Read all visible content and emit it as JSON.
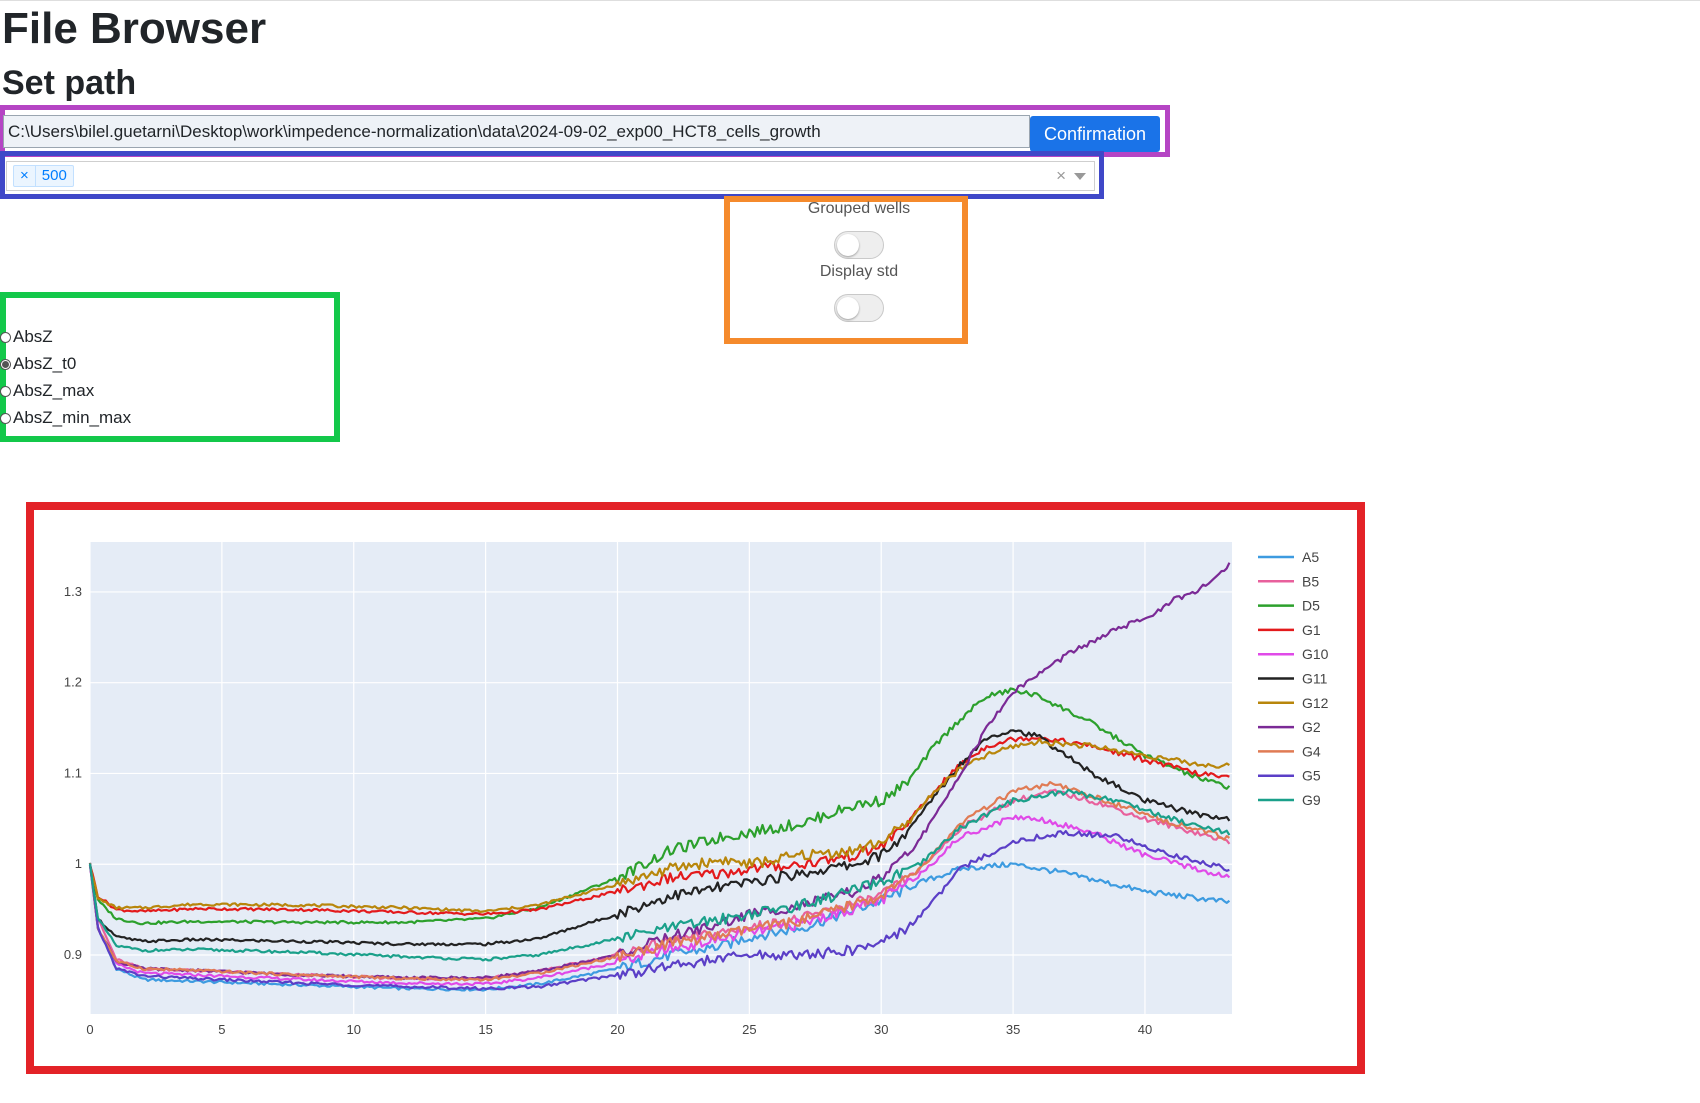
{
  "page": {
    "title": "File Browser",
    "subtitle": "Set path"
  },
  "path_row": {
    "path_value": "C:\\Users\\bilel.guetarni\\Desktop\\work\\impedence-normalization\\data\\2024-09-02_exp00_HCT8_cells_growth",
    "confirm_label": "Confirmation"
  },
  "multiselect": {
    "selected": [
      "500"
    ],
    "remove_tag_glyph": "×",
    "clear_glyph": "×"
  },
  "toggles": [
    {
      "label": "Grouped wells",
      "on": false
    },
    {
      "label": "Display std",
      "on": false
    }
  ],
  "normalization": {
    "options": [
      "AbsZ",
      "AbsZ_t0",
      "AbsZ_max",
      "AbsZ_min_max"
    ],
    "selected": "AbsZ_t0"
  },
  "chart_data": {
    "type": "line",
    "title": "",
    "xlabel": "",
    "ylabel": "",
    "xlim": [
      0,
      43.3
    ],
    "ylim": [
      0.835,
      1.355
    ],
    "x_ticks": [
      0,
      5,
      10,
      15,
      20,
      25,
      30,
      35,
      40
    ],
    "y_ticks": [
      0.9,
      1,
      1.1,
      1.2,
      1.3
    ],
    "grid": true,
    "legend_position": "right",
    "background": "#e5ecf6",
    "series": [
      {
        "name": "A5",
        "color": "#3d9be0",
        "points": [
          [
            0,
            1
          ],
          [
            0.3,
            0.93
          ],
          [
            1,
            0.885
          ],
          [
            2,
            0.873
          ],
          [
            4,
            0.871
          ],
          [
            8,
            0.867
          ],
          [
            12,
            0.863
          ],
          [
            15,
            0.862
          ],
          [
            17,
            0.868
          ],
          [
            20,
            0.885
          ],
          [
            22,
            0.9
          ],
          [
            24,
            0.91
          ],
          [
            25,
            0.92
          ],
          [
            27,
            0.93
          ],
          [
            30,
            0.96
          ],
          [
            31.5,
            0.98
          ],
          [
            33,
            0.995
          ],
          [
            35,
            1.0
          ],
          [
            37,
            0.99
          ],
          [
            40,
            0.97
          ],
          [
            43.2,
            0.958
          ]
        ]
      },
      {
        "name": "B5",
        "color": "#e8609c",
        "points": [
          [
            0,
            1
          ],
          [
            0.3,
            0.94
          ],
          [
            1,
            0.895
          ],
          [
            2,
            0.885
          ],
          [
            4,
            0.883
          ],
          [
            8,
            0.878
          ],
          [
            12,
            0.874
          ],
          [
            15,
            0.874
          ],
          [
            17,
            0.882
          ],
          [
            20,
            0.9
          ],
          [
            22,
            0.915
          ],
          [
            24,
            0.925
          ],
          [
            25,
            0.93
          ],
          [
            27,
            0.94
          ],
          [
            30,
            0.965
          ],
          [
            31.5,
            0.995
          ],
          [
            33,
            1.04
          ],
          [
            35,
            1.07
          ],
          [
            36.5,
            1.08
          ],
          [
            38,
            1.07
          ],
          [
            40,
            1.05
          ],
          [
            43.2,
            1.025
          ]
        ]
      },
      {
        "name": "D5",
        "color": "#2ca02c",
        "points": [
          [
            0,
            1
          ],
          [
            0.3,
            0.96
          ],
          [
            1,
            0.94
          ],
          [
            2,
            0.935
          ],
          [
            4,
            0.937
          ],
          [
            8,
            0.936
          ],
          [
            12,
            0.936
          ],
          [
            15,
            0.94
          ],
          [
            17,
            0.952
          ],
          [
            20,
            0.985
          ],
          [
            22,
            1.015
          ],
          [
            24,
            1.03
          ],
          [
            25,
            1.035
          ],
          [
            27,
            1.045
          ],
          [
            29,
            1.065
          ],
          [
            30,
            1.07
          ],
          [
            31,
            1.09
          ],
          [
            32,
            1.13
          ],
          [
            33,
            1.16
          ],
          [
            34,
            1.185
          ],
          [
            35,
            1.192
          ],
          [
            36,
            1.185
          ],
          [
            38,
            1.155
          ],
          [
            40,
            1.12
          ],
          [
            42,
            1.095
          ],
          [
            43.2,
            1.085
          ]
        ]
      },
      {
        "name": "G1",
        "color": "#e31a1c",
        "points": [
          [
            0,
            1
          ],
          [
            0.3,
            0.965
          ],
          [
            1,
            0.95
          ],
          [
            2,
            0.948
          ],
          [
            4,
            0.951
          ],
          [
            8,
            0.95
          ],
          [
            12,
            0.947
          ],
          [
            15,
            0.945
          ],
          [
            17,
            0.95
          ],
          [
            20,
            0.97
          ],
          [
            22,
            0.985
          ],
          [
            24,
            0.99
          ],
          [
            25,
            0.995
          ],
          [
            27,
            1.0
          ],
          [
            29,
            1.01
          ],
          [
            30,
            1.02
          ],
          [
            31,
            1.045
          ],
          [
            32,
            1.08
          ],
          [
            33,
            1.11
          ],
          [
            34,
            1.13
          ],
          [
            35,
            1.138
          ],
          [
            36,
            1.14
          ],
          [
            38,
            1.13
          ],
          [
            40,
            1.115
          ],
          [
            42,
            1.1
          ],
          [
            43.2,
            1.095
          ]
        ]
      },
      {
        "name": "G10",
        "color": "#e04ae8",
        "points": [
          [
            0,
            1
          ],
          [
            0.3,
            0.93
          ],
          [
            1,
            0.89
          ],
          [
            2,
            0.88
          ],
          [
            4,
            0.878
          ],
          [
            8,
            0.873
          ],
          [
            12,
            0.869
          ],
          [
            15,
            0.868
          ],
          [
            17,
            0.875
          ],
          [
            20,
            0.892
          ],
          [
            22,
            0.907
          ],
          [
            24,
            0.918
          ],
          [
            25,
            0.925
          ],
          [
            27,
            0.935
          ],
          [
            30,
            0.96
          ],
          [
            31.5,
            0.99
          ],
          [
            33,
            1.03
          ],
          [
            35,
            1.052
          ],
          [
            36,
            1.05
          ],
          [
            38,
            1.035
          ],
          [
            40,
            1.01
          ],
          [
            43.2,
            0.985
          ]
        ]
      },
      {
        "name": "G11",
        "color": "#222222",
        "points": [
          [
            0,
            1
          ],
          [
            0.3,
            0.94
          ],
          [
            1,
            0.92
          ],
          [
            2,
            0.915
          ],
          [
            4,
            0.917
          ],
          [
            8,
            0.915
          ],
          [
            12,
            0.912
          ],
          [
            15,
            0.912
          ],
          [
            17,
            0.918
          ],
          [
            20,
            0.945
          ],
          [
            22,
            0.965
          ],
          [
            24,
            0.975
          ],
          [
            25,
            0.98
          ],
          [
            27,
            0.99
          ],
          [
            29,
            1.0
          ],
          [
            30,
            1.01
          ],
          [
            31,
            1.035
          ],
          [
            32,
            1.075
          ],
          [
            33,
            1.11
          ],
          [
            34,
            1.14
          ],
          [
            35,
            1.148
          ],
          [
            36,
            1.14
          ],
          [
            38,
            1.1
          ],
          [
            40,
            1.07
          ],
          [
            42,
            1.055
          ],
          [
            43.2,
            1.05
          ]
        ]
      },
      {
        "name": "G12",
        "color": "#b8860b",
        "points": [
          [
            0,
            1
          ],
          [
            0.3,
            0.962
          ],
          [
            1,
            0.952
          ],
          [
            2,
            0.952
          ],
          [
            4,
            0.956
          ],
          [
            8,
            0.955
          ],
          [
            12,
            0.952
          ],
          [
            15,
            0.948
          ],
          [
            17,
            0.955
          ],
          [
            20,
            0.978
          ],
          [
            22,
            0.995
          ],
          [
            24,
            1.005
          ],
          [
            25,
            1.0
          ],
          [
            27,
            1.01
          ],
          [
            29,
            1.015
          ],
          [
            30,
            1.025
          ],
          [
            31,
            1.045
          ],
          [
            32,
            1.08
          ],
          [
            33,
            1.105
          ],
          [
            34,
            1.12
          ],
          [
            35,
            1.13
          ],
          [
            36,
            1.135
          ],
          [
            38,
            1.13
          ],
          [
            40,
            1.12
          ],
          [
            42,
            1.11
          ],
          [
            43.2,
            1.108
          ]
        ]
      },
      {
        "name": "G2",
        "color": "#7b2a96",
        "points": [
          [
            0,
            1
          ],
          [
            0.3,
            0.93
          ],
          [
            1,
            0.893
          ],
          [
            2,
            0.885
          ],
          [
            4,
            0.883
          ],
          [
            8,
            0.878
          ],
          [
            12,
            0.875
          ],
          [
            15,
            0.875
          ],
          [
            17,
            0.882
          ],
          [
            20,
            0.9
          ],
          [
            22,
            0.92
          ],
          [
            24,
            0.935
          ],
          [
            25,
            0.945
          ],
          [
            27,
            0.955
          ],
          [
            29,
            0.97
          ],
          [
            30,
            0.985
          ],
          [
            31,
            1.01
          ],
          [
            32,
            1.05
          ],
          [
            33,
            1.1
          ],
          [
            34,
            1.15
          ],
          [
            35,
            1.19
          ],
          [
            36,
            1.21
          ],
          [
            37,
            1.23
          ],
          [
            38,
            1.245
          ],
          [
            39,
            1.26
          ],
          [
            40,
            1.27
          ],
          [
            41,
            1.29
          ],
          [
            42,
            1.3
          ],
          [
            43.2,
            1.33
          ]
        ]
      },
      {
        "name": "G4",
        "color": "#e07b54",
        "points": [
          [
            0,
            1
          ],
          [
            0.3,
            0.93
          ],
          [
            1,
            0.893
          ],
          [
            2,
            0.885
          ],
          [
            4,
            0.883
          ],
          [
            8,
            0.878
          ],
          [
            12,
            0.874
          ],
          [
            15,
            0.873
          ],
          [
            17,
            0.88
          ],
          [
            20,
            0.898
          ],
          [
            22,
            0.913
          ],
          [
            24,
            0.922
          ],
          [
            25,
            0.928
          ],
          [
            27,
            0.938
          ],
          [
            30,
            0.965
          ],
          [
            31.5,
            0.995
          ],
          [
            33,
            1.045
          ],
          [
            35,
            1.08
          ],
          [
            36.5,
            1.088
          ],
          [
            38,
            1.075
          ],
          [
            40,
            1.055
          ],
          [
            43.2,
            1.028
          ]
        ]
      },
      {
        "name": "G5",
        "color": "#5b3fc7",
        "points": [
          [
            0,
            1
          ],
          [
            0.3,
            0.93
          ],
          [
            1,
            0.885
          ],
          [
            2,
            0.877
          ],
          [
            4,
            0.874
          ],
          [
            8,
            0.869
          ],
          [
            12,
            0.865
          ],
          [
            15,
            0.863
          ],
          [
            17,
            0.865
          ],
          [
            20,
            0.878
          ],
          [
            22,
            0.888
          ],
          [
            24,
            0.896
          ],
          [
            25,
            0.9
          ],
          [
            27,
            0.9
          ],
          [
            29,
            0.905
          ],
          [
            30,
            0.915
          ],
          [
            31,
            0.93
          ],
          [
            32,
            0.96
          ],
          [
            33,
            0.995
          ],
          [
            35,
            1.025
          ],
          [
            37,
            1.035
          ],
          [
            39,
            1.03
          ],
          [
            41,
            1.01
          ],
          [
            43.2,
            0.995
          ]
        ]
      },
      {
        "name": "G9",
        "color": "#1aa08a",
        "points": [
          [
            0,
            1
          ],
          [
            0.3,
            0.94
          ],
          [
            1,
            0.91
          ],
          [
            2,
            0.905
          ],
          [
            4,
            0.906
          ],
          [
            8,
            0.903
          ],
          [
            12,
            0.898
          ],
          [
            15,
            0.895
          ],
          [
            17,
            0.9
          ],
          [
            20,
            0.918
          ],
          [
            22,
            0.93
          ],
          [
            24,
            0.94
          ],
          [
            25,
            0.945
          ],
          [
            27,
            0.955
          ],
          [
            30,
            0.98
          ],
          [
            31.5,
            1.0
          ],
          [
            33,
            1.04
          ],
          [
            35,
            1.07
          ],
          [
            37,
            1.08
          ],
          [
            39,
            1.07
          ],
          [
            41,
            1.05
          ],
          [
            43.2,
            1.035
          ]
        ]
      }
    ]
  }
}
